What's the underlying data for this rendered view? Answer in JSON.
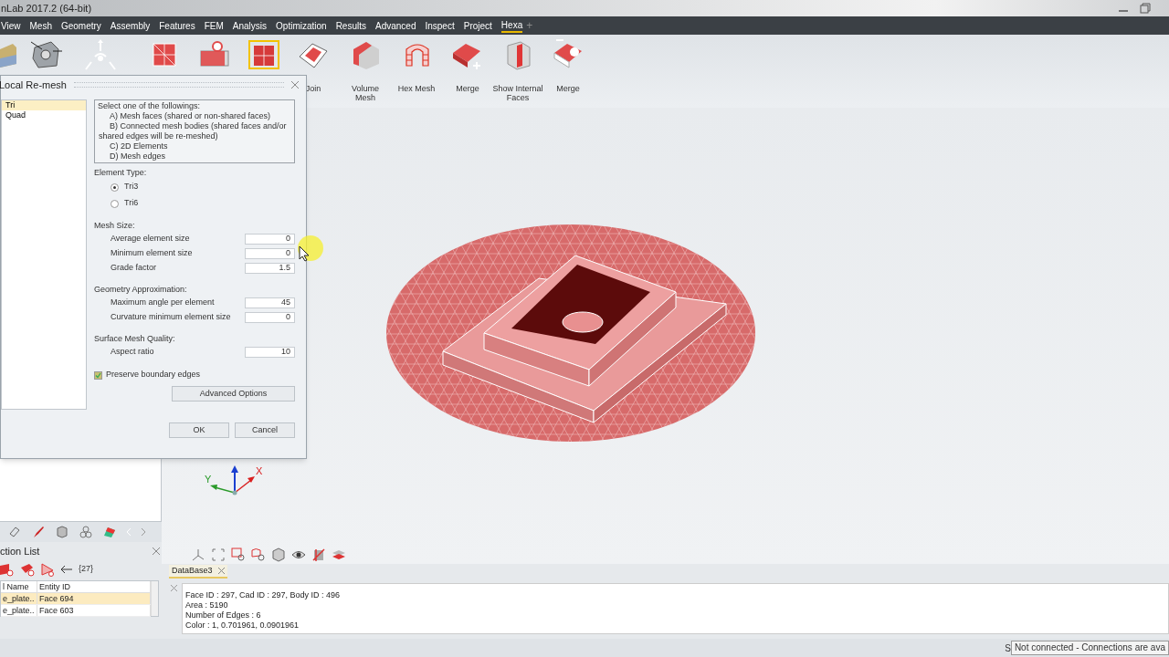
{
  "window": {
    "title": "nLab 2017.2 (64-bit)"
  },
  "menu": [
    {
      "label": "View",
      "selected": false
    },
    {
      "label": "Mesh",
      "selected": false
    },
    {
      "label": "Geometry",
      "selected": false
    },
    {
      "label": "Assembly",
      "selected": false
    },
    {
      "label": "Features",
      "selected": false
    },
    {
      "label": "FEM",
      "selected": false
    },
    {
      "label": "Analysis",
      "selected": false
    },
    {
      "label": "Optimization",
      "selected": false
    },
    {
      "label": "Results",
      "selected": false
    },
    {
      "label": "Advanced",
      "selected": false
    },
    {
      "label": "Inspect",
      "selected": false
    },
    {
      "label": "Project",
      "selected": false
    },
    {
      "label": "Hexa",
      "selected": true
    }
  ],
  "menu_add": "+",
  "ribbon": [
    {
      "label": "Join"
    },
    {
      "label": "Volume Mesh"
    },
    {
      "label": "Hex Mesh"
    },
    {
      "label": "Merge"
    },
    {
      "label": "Show Internal Faces"
    },
    {
      "label": "Merge"
    }
  ],
  "dialog": {
    "title": "Local Re-mesh",
    "types": [
      {
        "label": "Tri",
        "selected": true
      },
      {
        "label": "Quad",
        "selected": false
      }
    ],
    "instructions": [
      "Select one of the followings:",
      "A) Mesh faces (shared or non-shared faces)",
      "B) Connected mesh bodies (shared faces and/or shared edges will be re-meshed)",
      "C) 2D Elements",
      "D) Mesh edges"
    ],
    "sections": [
      {
        "heading": "Element Type:",
        "rows": [
          {
            "kind": "radio",
            "label": "Tri3",
            "selected": true
          },
          {
            "kind": "radio",
            "label": "Tri6",
            "selected": false
          }
        ]
      },
      {
        "heading": "Mesh Size:",
        "rows": [
          {
            "kind": "field",
            "label": "Average element size",
            "value": "0"
          },
          {
            "kind": "field",
            "label": "Minimum element size",
            "value": "0"
          },
          {
            "kind": "field",
            "label": "Grade factor",
            "value": "1.5"
          }
        ]
      },
      {
        "heading": "Geometry Approximation:",
        "rows": [
          {
            "kind": "field",
            "label": "Maximum angle per element",
            "value": "45"
          },
          {
            "kind": "field",
            "label": "Curvature minimum element size",
            "value": "0"
          }
        ]
      },
      {
        "heading": "Surface Mesh Quality:",
        "rows": [
          {
            "kind": "field",
            "label": "Aspect ratio",
            "value": "10"
          }
        ]
      }
    ],
    "preserve": {
      "label": "Preserve boundary edges",
      "checked": true
    },
    "advanced": "Advanced Options",
    "ok": "OK",
    "cancel": "Cancel"
  },
  "triad": {
    "x_label": "X",
    "y_label": "Y"
  },
  "selection": {
    "title": "ction List",
    "count": "{27}",
    "columns": [
      "l Name",
      "Entity ID"
    ],
    "rows": [
      {
        "cells": [
          "e_plate..",
          "Face 694"
        ],
        "selected": true
      },
      {
        "cells": [
          "e_plate..",
          "Face 603"
        ],
        "selected": false
      }
    ]
  },
  "info": {
    "tab": "DataBase3",
    "lines": [
      "Face ID : 297, Cad ID : 297, Body ID : 496",
      "Area : 5190",
      "Number of Edges : 6",
      "Color : 1, 0.701961, 0.0901961"
    ]
  },
  "status": {
    "text": "S",
    "tooltip": "Not connected - Connections are ava"
  }
}
